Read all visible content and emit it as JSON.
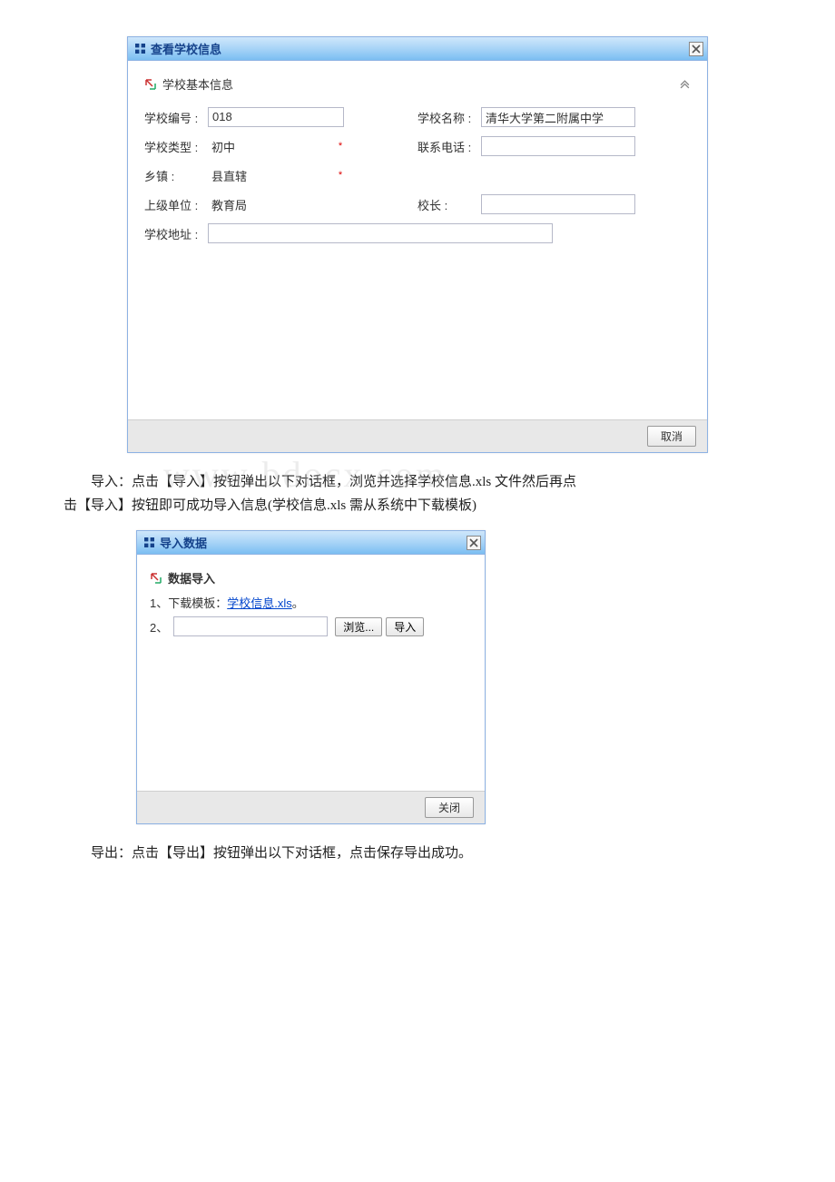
{
  "dialog1": {
    "title": "查看学校信息",
    "section_title": "学校基本信息",
    "labels": {
      "school_no": "学校编号 :",
      "school_name": "学校名称 :",
      "school_type": "学校类型 :",
      "phone": "联系电话 :",
      "township": "乡镇 :",
      "superior": "上级单位 :",
      "principal": "校长 :",
      "address": "学校地址 :"
    },
    "values": {
      "school_no": "018",
      "school_name": "清华大学第二附属中学",
      "school_type": "初中",
      "phone": "",
      "township": "县直辖",
      "superior": "教育局",
      "principal": "",
      "address": ""
    },
    "required_mark": "*",
    "footer": {
      "cancel": "取消"
    }
  },
  "paragraph1_a": "导入：点击【导入】按钮弹出以下对话框，浏览并选择学校信息.xls 文件然后再点",
  "paragraph1_b": "击【导入】按钮即可成功导入信息(学校信息.xls 需从系统中下载模板)",
  "watermark": "www bdocx com",
  "dialog2": {
    "title": "导入数据",
    "section_title": "数据导入",
    "line1_prefix": "1、下载模板：",
    "line1_link": "学校信息.xls",
    "line1_suffix": "。",
    "line2_prefix": "2、",
    "browse_btn": "浏览...",
    "import_btn": "导入",
    "footer": {
      "close": "关闭"
    }
  },
  "paragraph2": "导出：点击【导出】按钮弹出以下对话框，点击保存导出成功。"
}
